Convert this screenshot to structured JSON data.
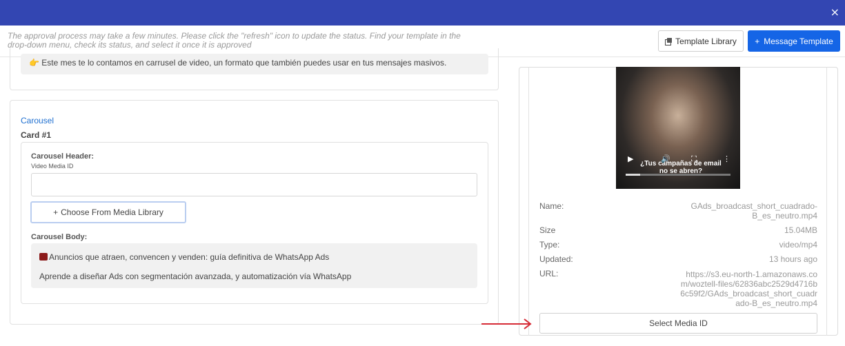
{
  "header": {
    "notice": "The approval process may take a few minutes. Please click the \"refresh\" icon to update the status. Find your template in the drop-down menu, check its status, and select it once it is approved",
    "template_library_label": "Template Library",
    "message_template_label": "Message Template",
    "close_symbol": "×",
    "plus_symbol": "+"
  },
  "top_note": {
    "emoji": "👉",
    "text": "Este mes te lo contamos en carrusel de video, un formato que también puedes usar en tus mensajes masivos."
  },
  "carousel": {
    "title": "Carousel",
    "card_label": "Card #1",
    "header_label": "Carousel Header:",
    "video_label": "Video Media ID",
    "video_value": "",
    "choose_symbol": "+",
    "choose_label": "Choose From Media Library",
    "body_label": "Carousel Body:",
    "body_line1": "Anuncios que atraen, convencen y venden: guía definitiva de WhatsApp Ads",
    "body_line2": "Aprende a diseñar Ads con segmentación avanzada, y automatización vía WhatsApp"
  },
  "media": {
    "video_caption": "¿Tus campañas de email no se abren?",
    "progress_fraction": 0.14,
    "name_label": "Name:",
    "name_value": "GAds_broadcast_short_cuadrado-B_es_neutro.mp4",
    "size_label": "Size",
    "size_value": "15.04MB",
    "type_label": "Type:",
    "type_value": "video/mp4",
    "updated_label": "Updated:",
    "updated_value": "13 hours ago",
    "url_label": "URL:",
    "url_value": "https://s3.eu-north-1.amazonaws.com/woztell-files/62836abc2529d4716b6c59f2/GAds_broadcast_short_cuadrado-B_es_neutro.mp4",
    "select_label": "Select Media ID"
  },
  "colors": {
    "topbar": "#3346b2",
    "primary_button": "#1565e6",
    "link": "#1e6fd0",
    "annotation_arrow": "#d62b36"
  }
}
